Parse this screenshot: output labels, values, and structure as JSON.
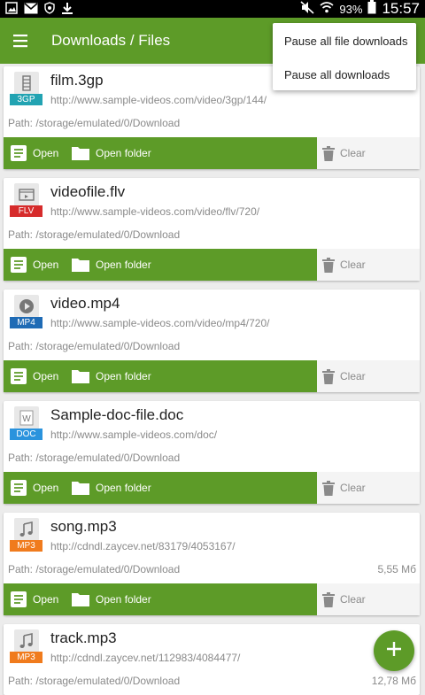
{
  "status_bar": {
    "battery": "93%",
    "time": "15:57",
    "left_icons": [
      "image-icon",
      "gmail-icon",
      "shield-icon",
      "download-icon"
    ],
    "right_icons": [
      "mute-icon",
      "wifi-icon",
      "battery-icon"
    ]
  },
  "toolbar": {
    "title": "Downloads / Files",
    "menu_icon": "menu-icon"
  },
  "menu": {
    "items": [
      "Pause all file downloads",
      "Pause all downloads"
    ]
  },
  "actions": {
    "open": "Open",
    "open_folder": "Open folder",
    "clear": "Clear"
  },
  "downloads": [
    {
      "name": "film.3gp",
      "tag": "3GP",
      "tag_color": "#22a3b2",
      "icon": "film-icon",
      "url": "http://www.sample-videos.com/video/3gp/144/",
      "path": "Path: /storage/emulated/0/Download",
      "size": ""
    },
    {
      "name": "videofile.flv",
      "tag": "FLV",
      "tag_color": "#d62b2b",
      "icon": "video-window-icon",
      "url": "http://www.sample-videos.com/video/flv/720/",
      "path": "Path: /storage/emulated/0/Download",
      "size": ""
    },
    {
      "name": "video.mp4",
      "tag": "MP4",
      "tag_color": "#1f6bb5",
      "icon": "play-icon",
      "url": "http://www.sample-videos.com/video/mp4/720/",
      "path": "Path: /storage/emulated/0/Download",
      "size": ""
    },
    {
      "name": "Sample-doc-file.doc",
      "tag": "DOC",
      "tag_color": "#2a93dd",
      "icon": "word-doc-icon",
      "url": "http://www.sample-videos.com/doc/",
      "path": "Path: /storage/emulated/0/Download",
      "size": ""
    },
    {
      "name": "song.mp3",
      "tag": "MP3",
      "tag_color": "#f07b1d",
      "icon": "music-note-icon",
      "url": "http://cdndl.zaycev.net/83179/4053167/",
      "path": "Path: /storage/emulated/0/Download",
      "size": "5,55 Мб"
    },
    {
      "name": "track.mp3",
      "tag": "MP3",
      "tag_color": "#f07b1d",
      "icon": "music-note-icon",
      "url": "http://cdndl.zaycev.net/112983/4084477/",
      "path": "Path: /storage/emulated/0/Download",
      "size": "12,78 Мб"
    }
  ],
  "fab": {
    "icon": "plus-icon"
  },
  "colors": {
    "accent": "#5d9b28"
  }
}
